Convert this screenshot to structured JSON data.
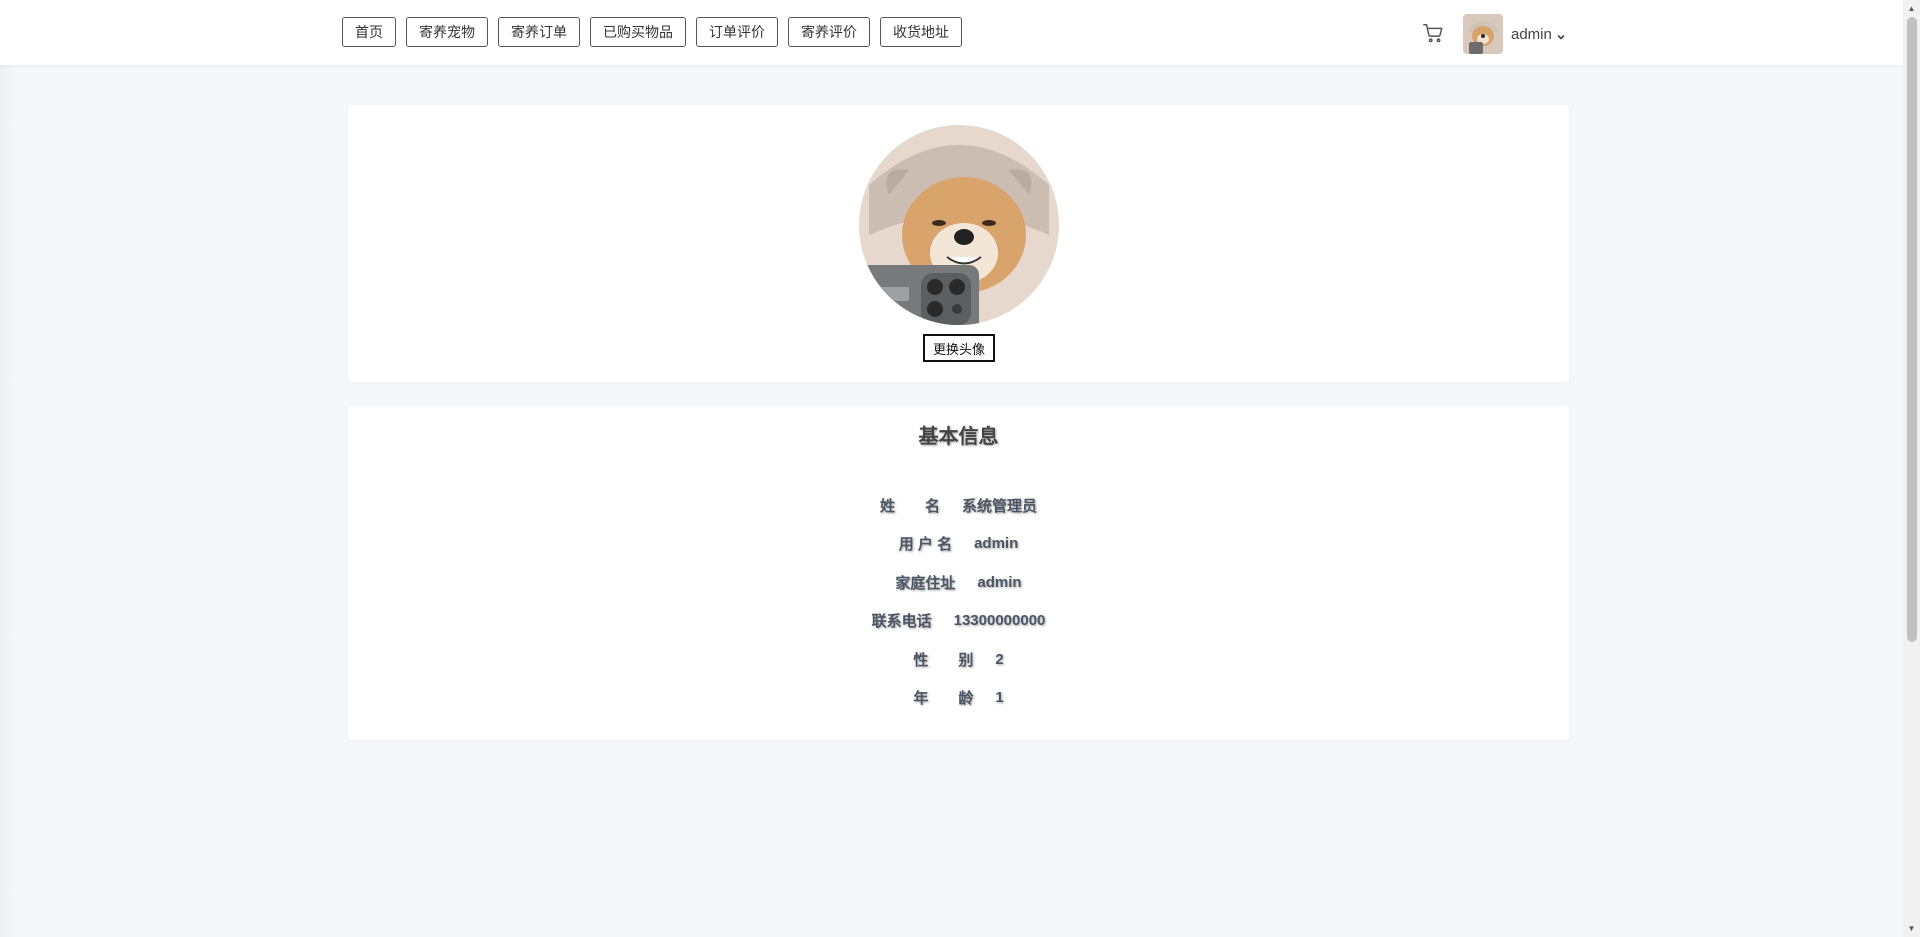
{
  "nav": {
    "items": [
      {
        "label": "首页"
      },
      {
        "label": "寄养宠物"
      },
      {
        "label": "寄养订单"
      },
      {
        "label": "已购买物品"
      },
      {
        "label": "订单评价"
      },
      {
        "label": "寄养评价"
      },
      {
        "label": "收货地址"
      }
    ],
    "cart_icon": "shopping-cart-icon",
    "user": {
      "name": "admin",
      "dropdown_icon": "chevron-down-icon"
    }
  },
  "profile": {
    "change_avatar_label": "更换头像"
  },
  "info": {
    "title": "基本信息",
    "rows": [
      {
        "label": "姓　　名",
        "value": "系统管理员"
      },
      {
        "label": "用 户 名",
        "value": "admin"
      },
      {
        "label": "家庭住址",
        "value": "admin"
      },
      {
        "label": "联系电话",
        "value": "13300000000"
      },
      {
        "label": "性　　别",
        "value": "2"
      },
      {
        "label": "年　　龄",
        "value": "1"
      }
    ]
  },
  "colors": {
    "background": "#f6f7fb",
    "card": "#ffffff",
    "text": "#4b5563"
  }
}
